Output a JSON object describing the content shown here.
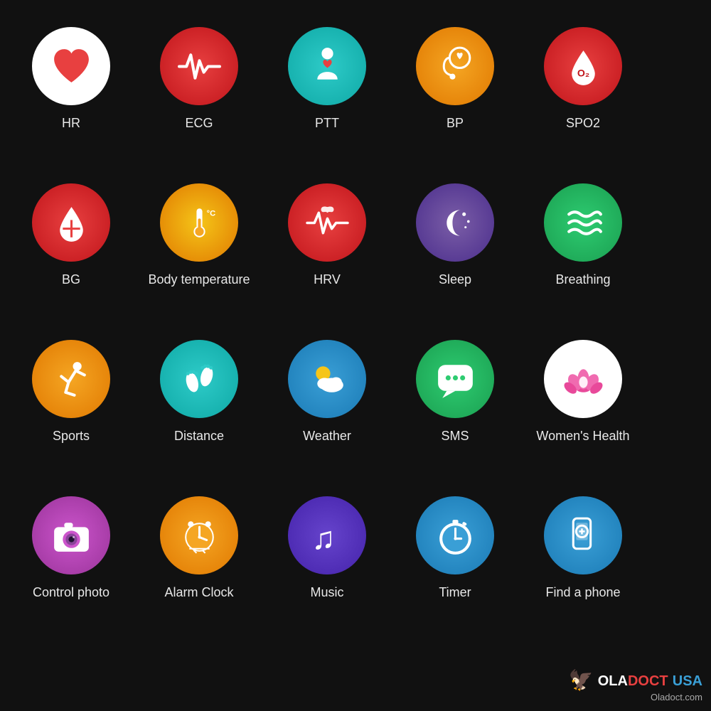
{
  "grid": {
    "rows": [
      [
        {
          "id": "hr",
          "label": "HR",
          "bg": "hr-bg",
          "icon": "heart"
        },
        {
          "id": "ecg",
          "label": "ECG",
          "bg": "ecg-bg",
          "icon": "ecg"
        },
        {
          "id": "ptt",
          "label": "PTT",
          "bg": "ptt-bg",
          "icon": "ptt"
        },
        {
          "id": "bp",
          "label": "BP",
          "bg": "bp-bg",
          "icon": "bp"
        },
        {
          "id": "spo2",
          "label": "SPO2",
          "bg": "spo2-bg",
          "icon": "spo2"
        }
      ],
      [
        {
          "id": "bg",
          "label": "BG",
          "bg": "bg-bg",
          "icon": "bg"
        },
        {
          "id": "temp",
          "label": "Body temperature",
          "bg": "temp-bg",
          "icon": "temp"
        },
        {
          "id": "hrv",
          "label": "HRV",
          "bg": "hrv-bg",
          "icon": "hrv"
        },
        {
          "id": "sleep",
          "label": "Sleep",
          "bg": "sleep-bg",
          "icon": "sleep"
        },
        {
          "id": "breathing",
          "label": "Breathing",
          "bg": "breathing-bg",
          "icon": "breathing"
        }
      ],
      [
        {
          "id": "sports",
          "label": "Sports",
          "bg": "sports-bg",
          "icon": "sports"
        },
        {
          "id": "distance",
          "label": "Distance",
          "bg": "distance-bg",
          "icon": "distance"
        },
        {
          "id": "weather",
          "label": "Weather",
          "bg": "weather-bg",
          "icon": "weather"
        },
        {
          "id": "sms",
          "label": "SMS",
          "bg": "sms-bg",
          "icon": "sms"
        },
        {
          "id": "womens",
          "label": "Women's Health",
          "bg": "womens-bg",
          "icon": "womens"
        }
      ],
      [
        {
          "id": "photo",
          "label": "Control photo",
          "bg": "photo-bg",
          "icon": "photo"
        },
        {
          "id": "alarm",
          "label": "Alarm Clock",
          "bg": "alarm-bg",
          "icon": "alarm"
        },
        {
          "id": "music",
          "label": "Music",
          "bg": "music-bg",
          "icon": "music"
        },
        {
          "id": "timer",
          "label": "Timer",
          "bg": "timer-bg",
          "icon": "timer"
        },
        {
          "id": "findphone",
          "label": "Find a phone",
          "bg": "findphone-bg",
          "icon": "findphone"
        }
      ]
    ]
  },
  "watermark": {
    "brand": "OLADOCT USA",
    "site": "Oladoct.com"
  }
}
